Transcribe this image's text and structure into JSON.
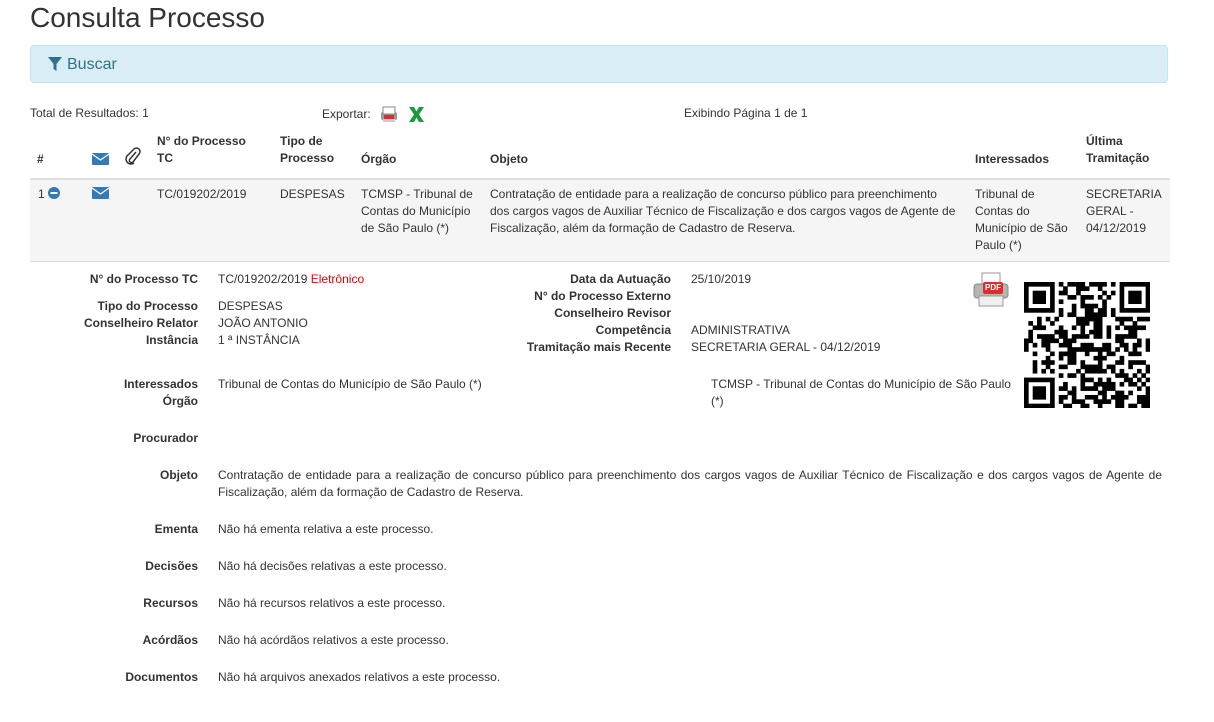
{
  "page_title": "Consulta Processo",
  "search": {
    "label": "Buscar"
  },
  "toolbar": {
    "total": "Total de Resultados: 1",
    "export_label": "Exportar:",
    "paging": "Exibindo Página 1 de 1"
  },
  "table": {
    "headers": {
      "num": "#",
      "processo_1": "N° do Processo",
      "processo_2": "TC",
      "tipo_1": "Tipo de",
      "tipo_2": "Processo",
      "orgao": "Órgão",
      "objeto": "Objeto",
      "interessados": "Interessados",
      "ultima_1": "Última",
      "ultima_2": "Tramitação"
    },
    "row": {
      "num": "1",
      "processo": "TC/019202/2019",
      "tipo": "DESPESAS",
      "orgao": [
        "TCMSP - Tribunal de",
        "Contas do Município",
        "de São Paulo (*)"
      ],
      "objeto": [
        "Contratação de entidade para a realização de concurso público para preenchimento",
        "dos cargos vagos de Auxiliar Técnico de Fiscalização e dos cargos vagos de Agente de",
        "Fiscalização, além da formação de Cadastro de Reserva."
      ],
      "interessados": [
        "Tribunal de",
        "Contas do",
        "Município de São",
        "Paulo (*)"
      ],
      "ultima": [
        "SECRETARIA",
        "GERAL -",
        "04/12/2019"
      ]
    }
  },
  "detail": {
    "labels": {
      "numero": "N° do Processo TC",
      "tipo": "Tipo do Processo",
      "relator": "Conselheiro Relator",
      "instancia": "Instância",
      "autuacao": "Data da Autuação",
      "externo": "N° do Processo Externo",
      "revisor": "Conselheiro Revisor",
      "competencia": "Competência",
      "tramitacao": "Tramitação mais Recente",
      "interessados": "Interessados",
      "orgao": "Órgão",
      "procurador": "Procurador",
      "objeto": "Objeto",
      "ementa": "Ementa",
      "decisoes": "Decisões",
      "recursos": "Recursos",
      "acordaos": "Acórdãos",
      "documentos": "Documentos"
    },
    "values": {
      "numero": "TC/019202/2019",
      "eletronico": "Eletrônico",
      "tipo": "DESPESAS",
      "relator": "JOÃO ANTONIO",
      "instancia": "1 ª INSTÂNCIA",
      "autuacao": "25/10/2019",
      "competencia": "ADMINISTRATIVA",
      "tramitacao": "SECRETARIA GERAL - 04/12/2019",
      "interessados": "Tribunal de Contas do Município de São Paulo (*)",
      "orgao": [
        "TCMSP - Tribunal de Contas do Município de São Paulo",
        "(*)"
      ],
      "objeto": [
        "Contratação de entidade para a realização de concurso público para preenchimento dos cargos vagos de Auxiliar Técnico de Fiscalização e dos cargos vagos de Agente de",
        "Fiscalização, além da formação de Cadastro de Reserva."
      ],
      "ementa": "Não há ementa relativa a este processo.",
      "decisoes": "Não há decisões relativas a este processo.",
      "recursos": "Não há recursos relativos a este processo.",
      "acordaos": "Não há acórdãos relativos a este processo.",
      "documentos": "Não há arquivos anexados relativos a este processo."
    },
    "pdf_label": "PDF"
  },
  "colors": {
    "accent": "#337ab7",
    "alert_bg": "#d9edf7",
    "alert_text": "#31708f",
    "excel_green": "#1d9a3a",
    "red": "#e00000"
  },
  "icons": [
    "filter-icon",
    "envelope-icon",
    "paperclip-icon",
    "pdf-icon",
    "excel-icon",
    "minus-circle-icon",
    "qr-code"
  ]
}
